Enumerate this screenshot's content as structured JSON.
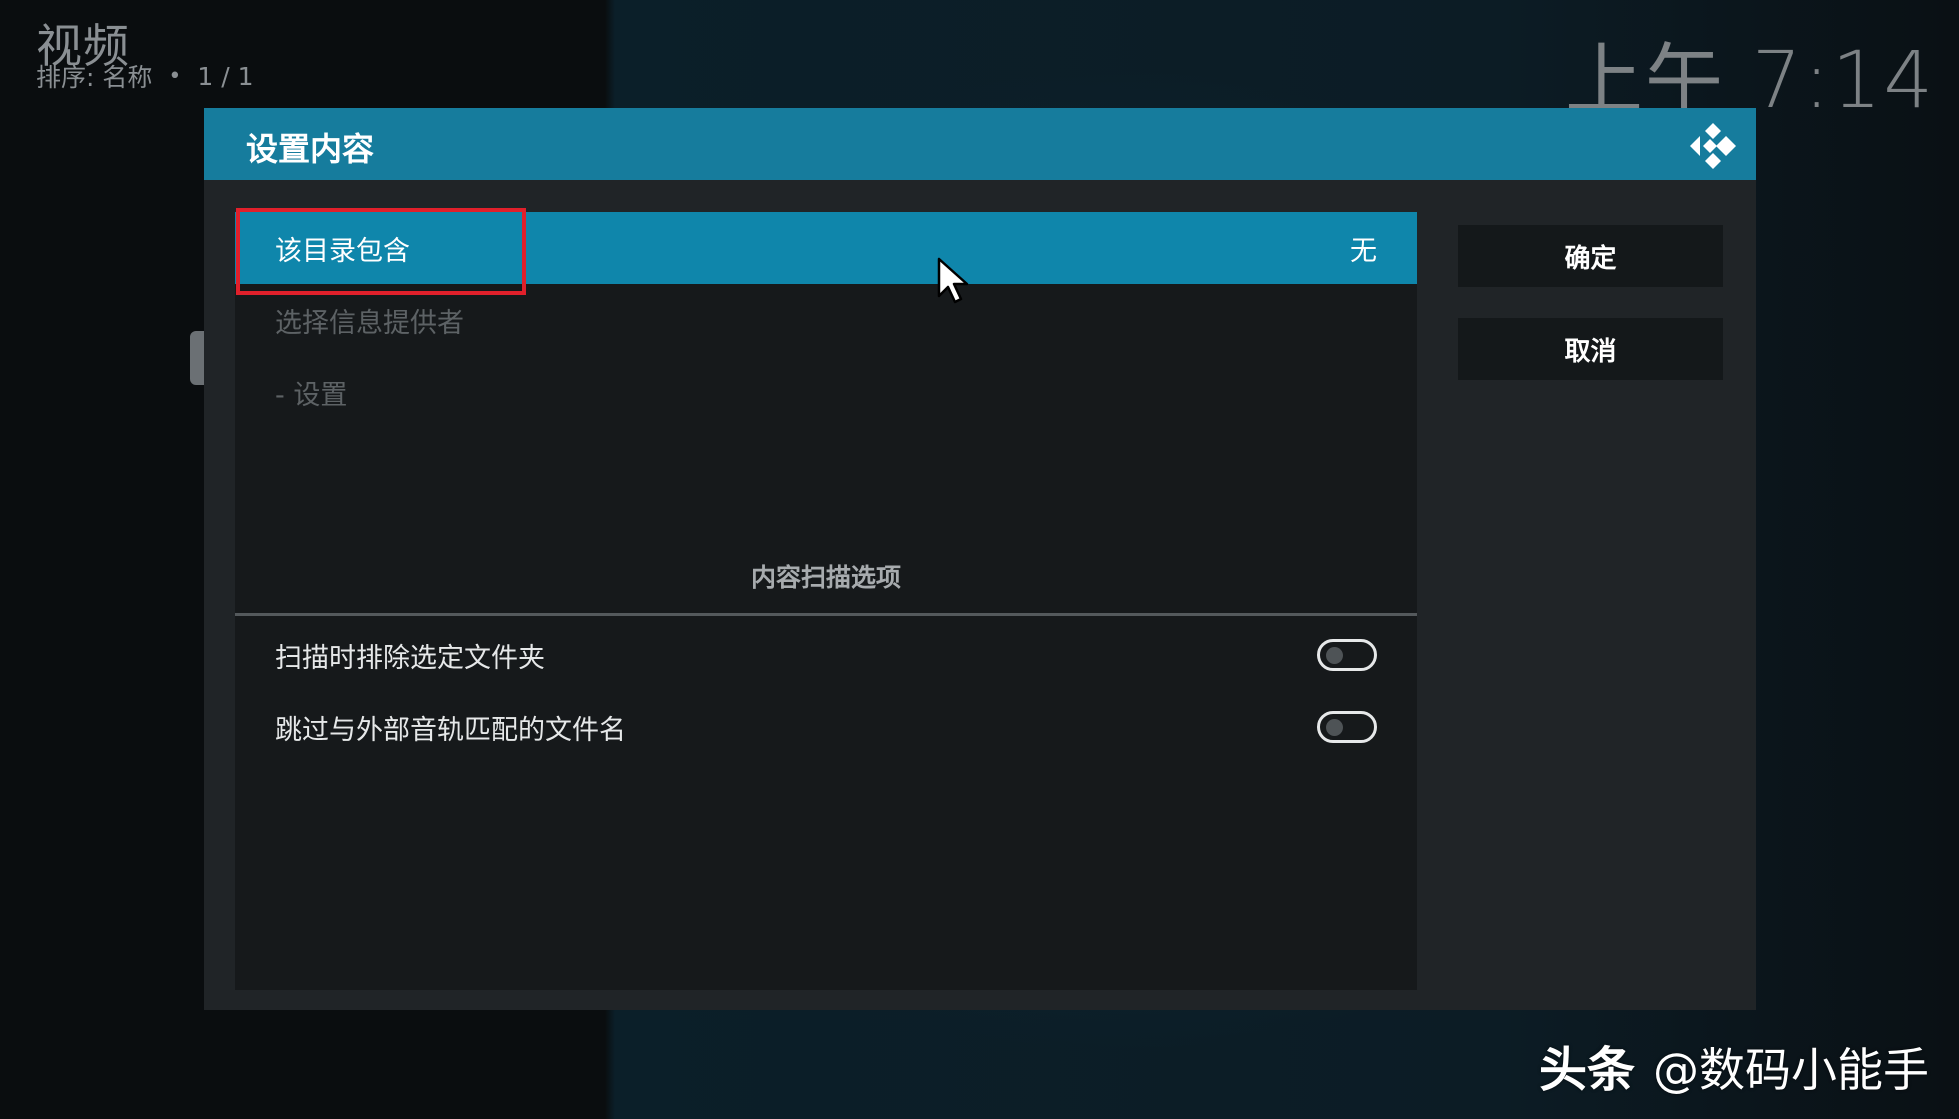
{
  "header": {
    "title": "视频",
    "sort_label": "排序: 名称",
    "separator": "•",
    "page_indicator": "1 / 1"
  },
  "clock": "上午 7:14",
  "dialog": {
    "title": "设置内容",
    "rows": [
      {
        "label": "该目录包含",
        "value": "无",
        "state": "selected"
      },
      {
        "label": "选择信息提供者",
        "state": "disabled"
      },
      {
        "label": "- 设置",
        "state": "disabled"
      }
    ],
    "section_label": "内容扫描选项",
    "toggles": [
      {
        "label": "扫描时排除选定文件夹",
        "on": false
      },
      {
        "label": "跳过与外部音轨匹配的文件名",
        "on": false
      }
    ],
    "buttons": {
      "ok_label": "确定",
      "cancel_label": "取消"
    }
  },
  "watermark": {
    "brand": "头条",
    "handle": "@数码小能手"
  },
  "colors": {
    "header_bar": "#167c9d",
    "selected_row": "#0f86ab",
    "annotation_box": "#e0202b"
  },
  "icons": {
    "kodi_logo": "kodi-logo-icon",
    "mouse_pointer": "mouse-pointer-icon"
  }
}
